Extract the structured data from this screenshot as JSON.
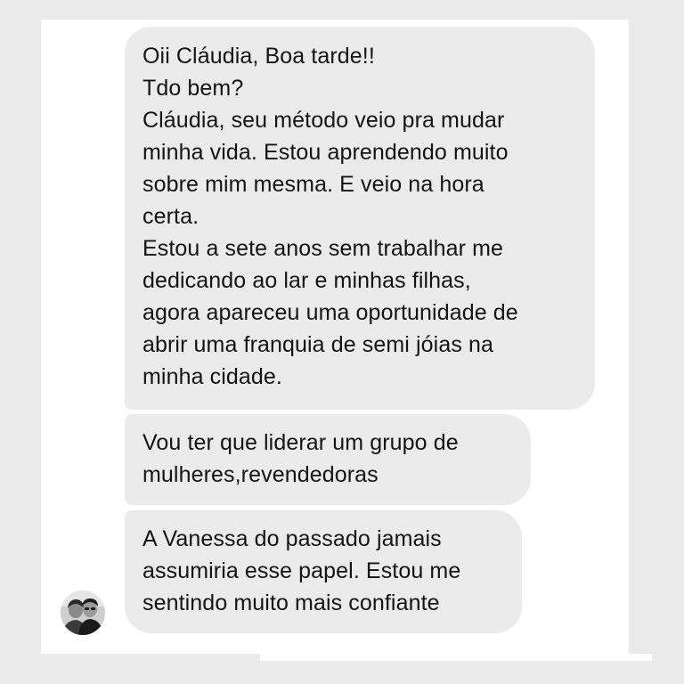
{
  "conversation": {
    "messages": [
      {
        "lines": [
          "Oii Cláudia,  Boa tarde!!",
          "Tdo bem?",
          "Cláudia, seu método veio pra mudar",
          "minha vida. Estou aprendendo muito",
          "sobre mim mesma. E veio na hora",
          "certa.",
          "Estou a sete anos sem trabalhar me",
          "dedicando ao lar e minhas filhas,",
          "agora apareceu uma oportunidade de",
          "abrir uma franquia de semi jóias na",
          "minha cidade."
        ]
      },
      {
        "lines": [
          "Vou ter que liderar um grupo de",
          "mulheres,revendedoras"
        ]
      },
      {
        "lines": [
          "A Vanessa do passado jamais",
          "assumiria esse papel. Estou me",
          "sentindo muito mais confiante"
        ]
      }
    ],
    "sender_avatar_icon": "profile-photo-avatar",
    "bubble_color": "#ebebeb",
    "text_color": "#141414"
  }
}
